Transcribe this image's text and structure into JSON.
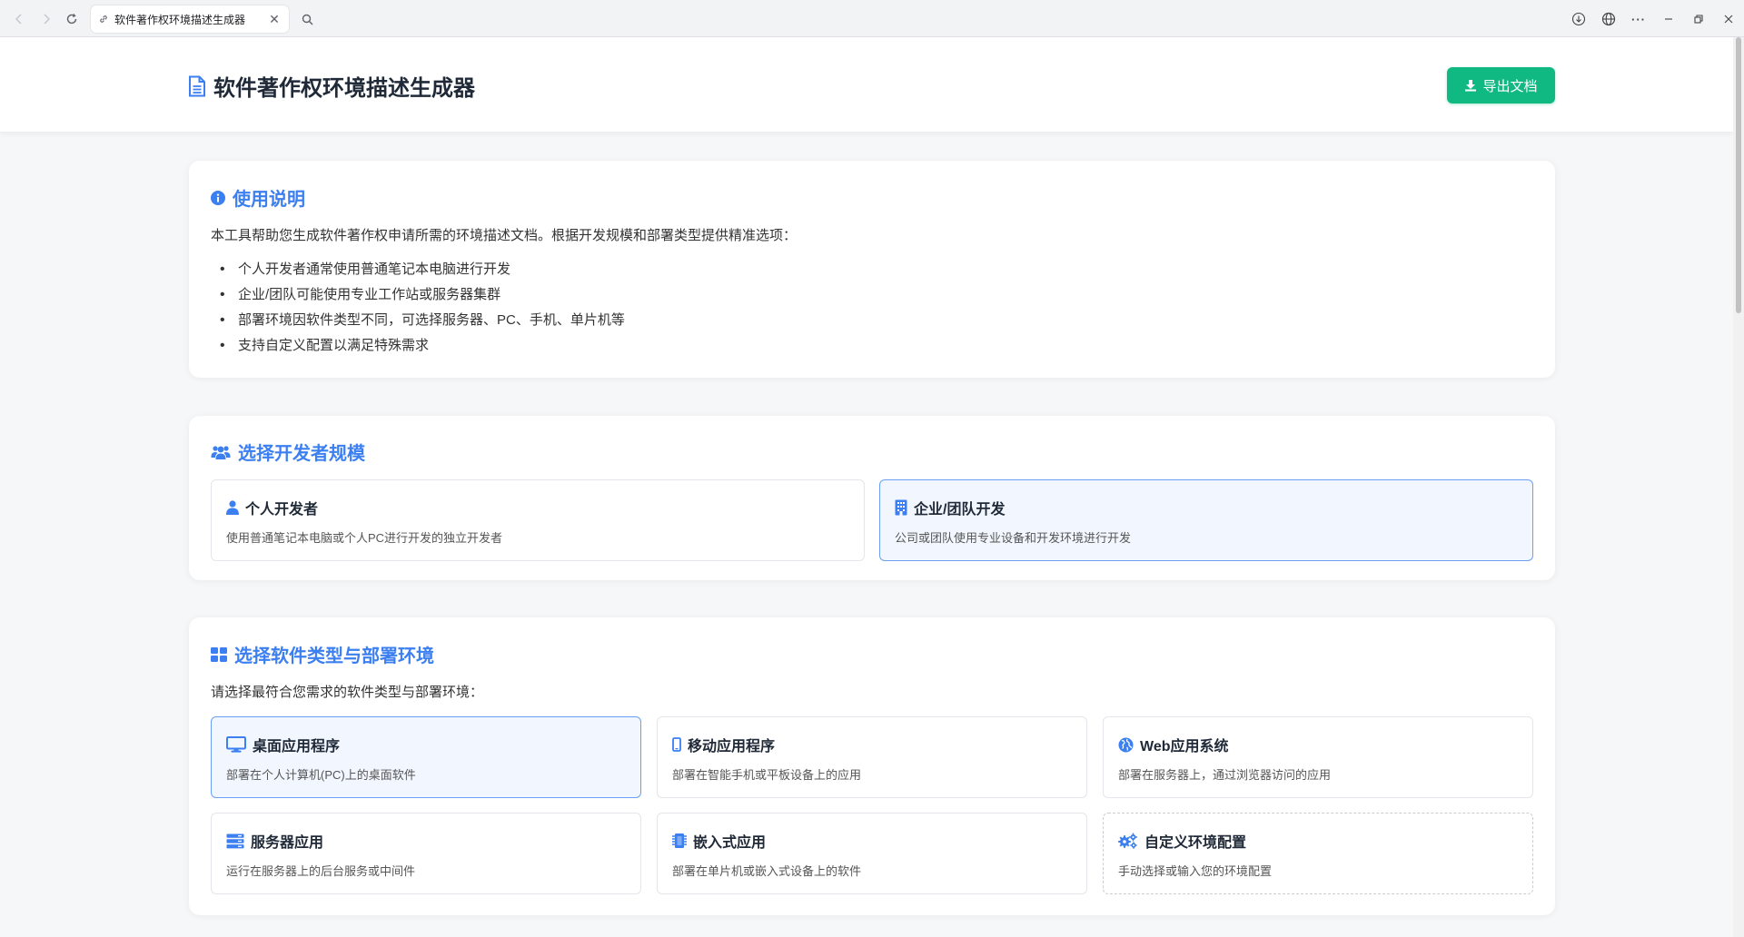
{
  "browser": {
    "tab_title": "软件著作权环境描述生成器"
  },
  "header": {
    "title": "软件著作权环境描述生成器",
    "export_label": "导出文档"
  },
  "instructions": {
    "heading": "使用说明",
    "intro": "本工具帮助您生成软件著作权申请所需的环境描述文档。根据开发规模和部署类型提供精准选项：",
    "items": [
      "个人开发者通常使用普通笔记本电脑进行开发",
      "企业/团队可能使用专业工作站或服务器集群",
      "部署环境因软件类型不同，可选择服务器、PC、手机、单片机等",
      "支持自定义配置以满足特殊需求"
    ]
  },
  "developer_scale": {
    "heading": "选择开发者规模",
    "options": [
      {
        "title": "个人开发者",
        "desc": "使用普通笔记本电脑或个人PC进行开发的独立开发者",
        "icon": "user-icon",
        "selected": false
      },
      {
        "title": "企业/团队开发",
        "desc": "公司或团队使用专业设备和开发环境进行开发",
        "icon": "building-icon",
        "selected": true
      }
    ]
  },
  "software_type": {
    "heading": "选择软件类型与部署环境",
    "subtitle": "请选择最符合您需求的软件类型与部署环境：",
    "options": [
      {
        "title": "桌面应用程序",
        "desc": "部署在个人计算机(PC)上的桌面软件",
        "icon": "desktop-icon",
        "selected": true
      },
      {
        "title": "移动应用程序",
        "desc": "部署在智能手机或平板设备上的应用",
        "icon": "mobile-icon",
        "selected": false
      },
      {
        "title": "Web应用系统",
        "desc": "部署在服务器上，通过浏览器访问的应用",
        "icon": "globe-icon",
        "selected": false
      },
      {
        "title": "服务器应用",
        "desc": "运行在服务器上的后台服务或中间件",
        "icon": "server-icon",
        "selected": false
      },
      {
        "title": "嵌入式应用",
        "desc": "部署在单片机或嵌入式设备上的软件",
        "icon": "chip-icon",
        "selected": false
      },
      {
        "title": "自定义环境配置",
        "desc": "手动选择或输入您的环境配置",
        "icon": "gears-icon",
        "selected": false
      }
    ]
  },
  "colors": {
    "accent": "#3b7ff0",
    "export_green": "#10b981",
    "selected_border": "#6a9ff5",
    "selected_bg": "#f2f7ff"
  }
}
